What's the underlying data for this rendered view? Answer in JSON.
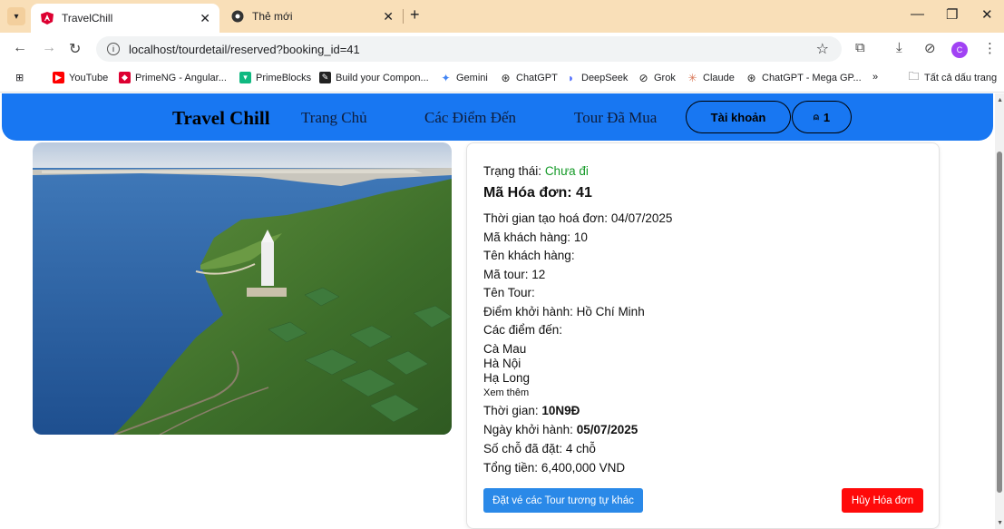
{
  "browser": {
    "tabs": [
      {
        "title": "TravelChill",
        "active": true
      },
      {
        "title": "Thẻ mới",
        "active": false
      }
    ],
    "url": "localhost/tourdetail/reserved?booking_id=41",
    "avatar_letter": "C",
    "bookmarks": [
      {
        "label": "YouTube",
        "icon": "youtube-icon",
        "color": "#ff0000"
      },
      {
        "label": "PrimeNG - Angular...",
        "icon": "primeng-icon",
        "color": "#dd0031"
      },
      {
        "label": "PrimeBlocks",
        "icon": "primeblocks-icon",
        "color": "#10b981"
      },
      {
        "label": "Build your Compon...",
        "icon": "build-icon",
        "color": "#222222"
      },
      {
        "label": "Gemini",
        "icon": "gemini-icon",
        "color": "#4285f4"
      },
      {
        "label": "ChatGPT",
        "icon": "chatgpt-icon",
        "color": "#222222"
      },
      {
        "label": "DeepSeek",
        "icon": "deepseek-icon",
        "color": "#4d6bfe"
      },
      {
        "label": "Grok",
        "icon": "grok-icon",
        "color": "#222222"
      },
      {
        "label": "Claude",
        "icon": "claude-icon",
        "color": "#d97757"
      },
      {
        "label": "ChatGPT - Mega GP...",
        "icon": "chatgpt-icon",
        "color": "#222222"
      }
    ],
    "bookmarks_more": "»",
    "all_bookmarks": "Tất cả dấu trang"
  },
  "site": {
    "brand": "Travel Chill",
    "nav": {
      "home": "Trang Chủ",
      "destinations": "Các Điểm Đến",
      "purchased": "Tour Đã Mua",
      "account": "Tài khoản",
      "notifications": "1"
    },
    "colors": {
      "navbar": "#1877f2",
      "status_green": "#159a28",
      "primary_button": "#2a89e8",
      "danger_button": "#ff0a0a"
    }
  },
  "booking": {
    "status_label": "Trạng thái:",
    "status_value": "Chưa đi",
    "invoice_label": "Mã Hóa đơn:",
    "invoice_id": "41",
    "created_label": "Thời gian tạo hoá đơn:",
    "created_value": "04/07/2025",
    "customer_id_label": "Mã khách hàng:",
    "customer_id_value": "10",
    "customer_name_label": "Tên khách hàng:",
    "tour_id_label": "Mã tour:",
    "tour_id_value": "12",
    "tour_name_label": "Tên Tour:",
    "departure_label": "Điểm khởi hành:",
    "departure_value": "Hồ Chí Minh",
    "destinations_label": "Các điểm đến:",
    "destinations": [
      "Cà Mau",
      "Hà Nội",
      "Hạ Long"
    ],
    "see_more": "Xem thêm",
    "duration_label": "Thời gian:",
    "duration_value": "10N9Đ",
    "start_label": "Ngày khởi hành:",
    "start_value": "05/07/2025",
    "seats_label": "Số chỗ đã đặt:",
    "seats_value": "4 chỗ",
    "total_label": "Tổng tiền:",
    "total_value": "6,400,000 VND",
    "book_similar": "Đặt vé các Tour tương tự khác",
    "cancel": "Hủy Hóa đơn"
  }
}
